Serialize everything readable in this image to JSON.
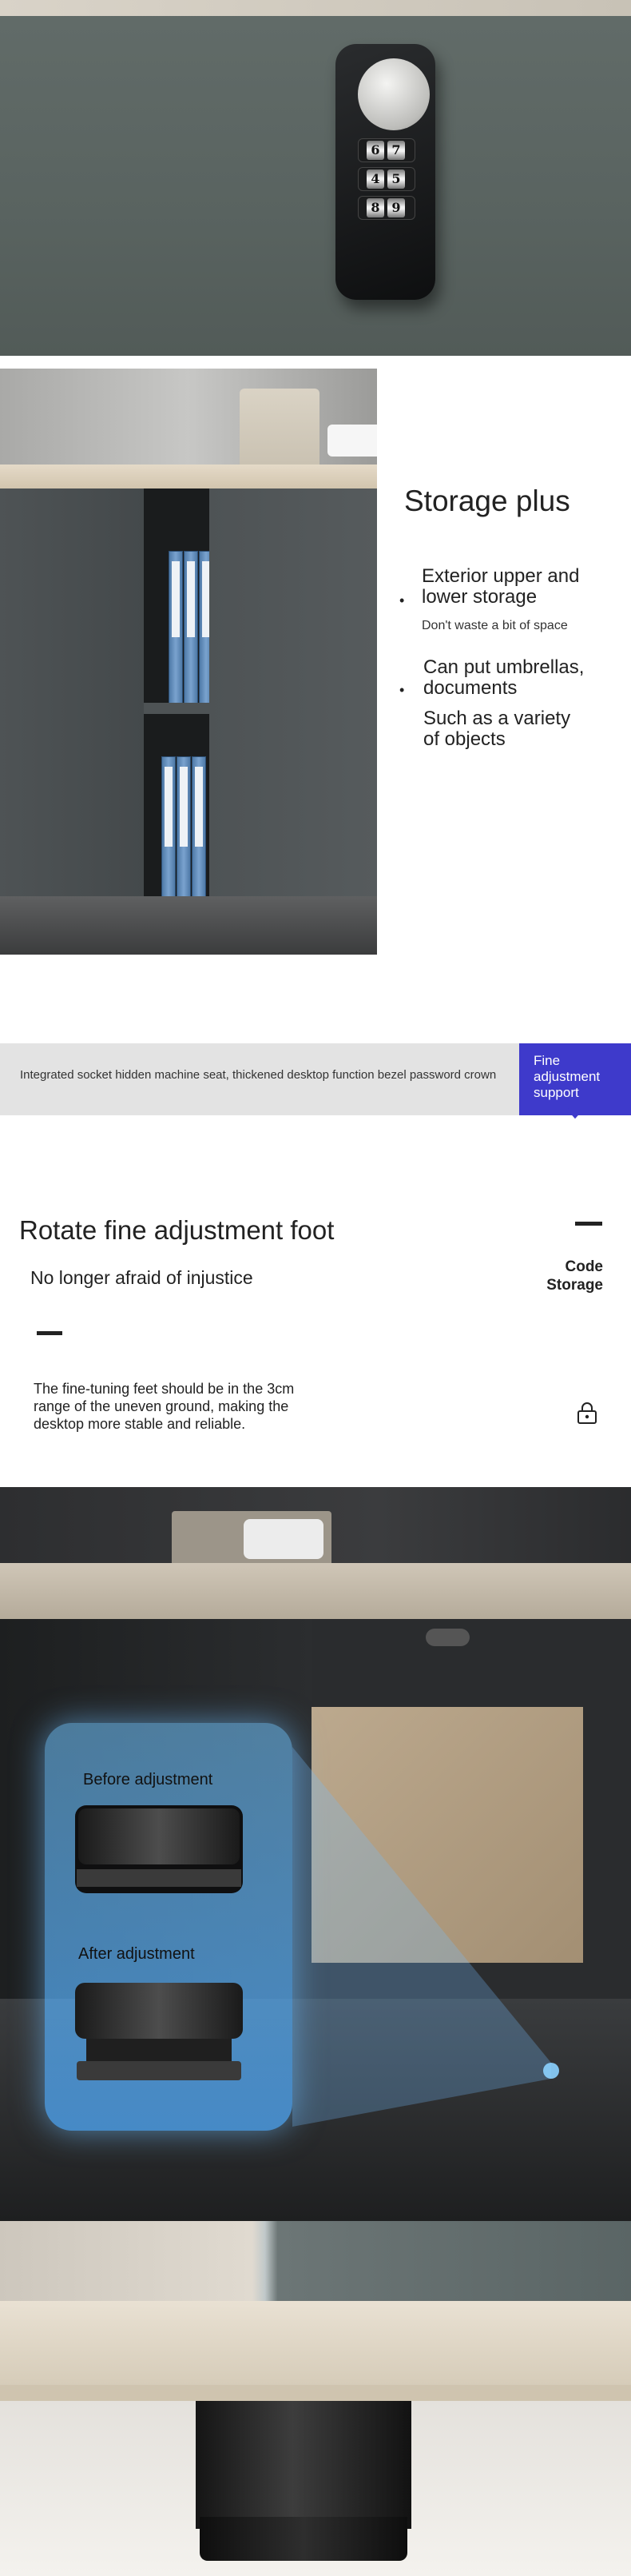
{
  "lock_closeup": {
    "dial_digits": [
      [
        "6",
        "7"
      ],
      [
        "4",
        "5"
      ],
      [
        "8",
        "9"
      ]
    ]
  },
  "storage": {
    "title": "Storage plus",
    "item1_line1": "Exterior upper and",
    "item1_line2": "lower storage",
    "item1_note": "Don't waste a bit of space",
    "item2_line1": "Can put umbrellas,",
    "item2_line2": "documents",
    "item2_line3": "Such as a variety",
    "item2_line4": "of objects"
  },
  "banner": {
    "text": "Integrated socket hidden machine seat, thickened desktop function bezel password crown",
    "tag_line1": "Fine",
    "tag_line2": "adjustment",
    "tag_line3": "support"
  },
  "feet": {
    "title": "Rotate fine adjustment foot",
    "subtitle": "No longer afraid of injustice",
    "code_line1": "Code",
    "code_line2": "Storage",
    "paragraph_line1": "The fine-tuning feet should be in the 3cm",
    "paragraph_line2": "range of the uneven ground, making the",
    "paragraph_line3": "desktop more stable and reliable.",
    "before_label": "Before adjustment",
    "after_label": "After adjustment"
  },
  "colors": {
    "accent": "#3e3acb",
    "banner_bg": "#e3e3e3",
    "cabinet_gray": "#596360",
    "glow_blue": "#70c4ff"
  },
  "icons": [
    "lock-icon",
    "chevron-down-icon"
  ]
}
